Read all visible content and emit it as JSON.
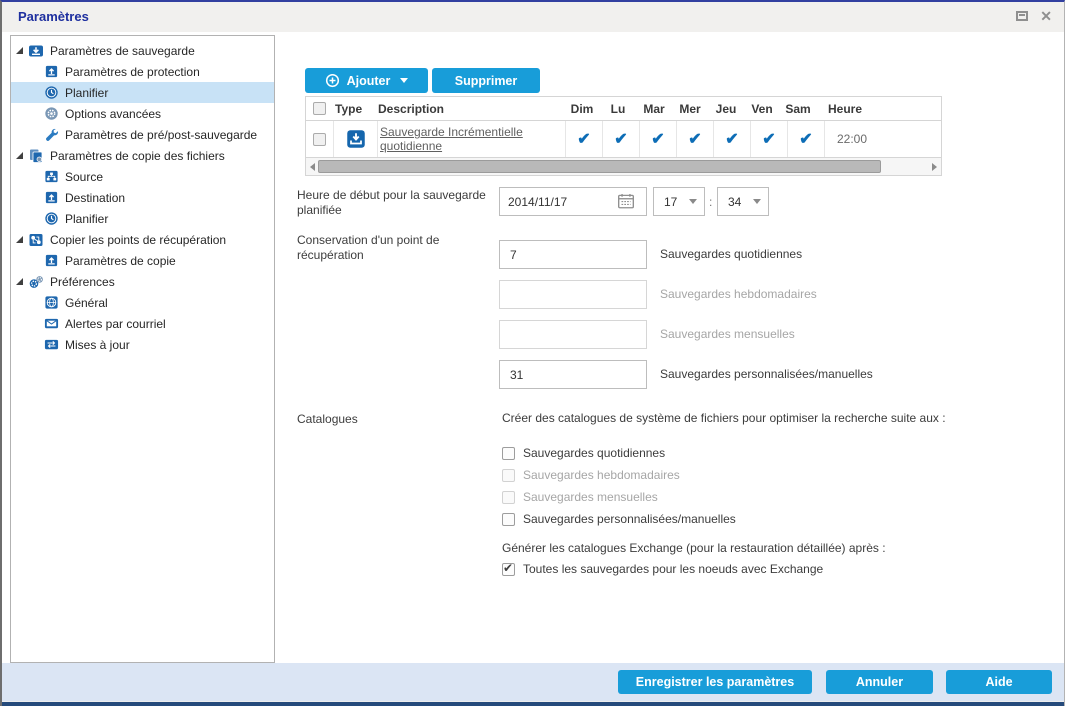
{
  "window": {
    "title": "Paramètres"
  },
  "sidebar": {
    "items": [
      {
        "label": "Paramètres de sauvegarde",
        "level": 0,
        "icon": "backup-settings",
        "expanded": true,
        "selected": false
      },
      {
        "label": "Paramètres de protection",
        "level": 1,
        "icon": "protection",
        "selected": false
      },
      {
        "label": "Planifier",
        "level": 1,
        "icon": "schedule",
        "selected": true
      },
      {
        "label": "Options avancées",
        "level": 1,
        "icon": "advanced-options",
        "selected": false
      },
      {
        "label": "Paramètres de pré/post-sauvegarde",
        "level": 1,
        "icon": "wrench",
        "selected": false
      },
      {
        "label": "Paramètres de copie des fichiers",
        "level": 0,
        "icon": "file-copy",
        "expanded": true,
        "selected": false
      },
      {
        "label": "Source",
        "level": 1,
        "icon": "network-source",
        "selected": false
      },
      {
        "label": "Destination",
        "level": 1,
        "icon": "protection",
        "selected": false
      },
      {
        "label": "Planifier",
        "level": 1,
        "icon": "schedule",
        "selected": false
      },
      {
        "label": "Copier les points de récupération",
        "level": 0,
        "icon": "recovery-copy",
        "expanded": true,
        "selected": false
      },
      {
        "label": "Paramètres de copie",
        "level": 1,
        "icon": "protection",
        "selected": false
      },
      {
        "label": "Préférences",
        "level": 0,
        "icon": "preferences",
        "expanded": true,
        "selected": false
      },
      {
        "label": "Général",
        "level": 1,
        "icon": "globe",
        "selected": false
      },
      {
        "label": "Alertes par courriel",
        "level": 1,
        "icon": "email",
        "selected": false
      },
      {
        "label": "Mises à jour",
        "level": 1,
        "icon": "updates",
        "selected": false
      }
    ]
  },
  "toolbar": {
    "add_label": "Ajouter",
    "delete_label": "Supprimer"
  },
  "schedule_table": {
    "col_type": "Type",
    "col_description": "Description",
    "day_columns": [
      "Dim",
      "Lu",
      "Mar",
      "Mer",
      "Jeu",
      "Ven",
      "Sam"
    ],
    "col_time": "Heure",
    "rows": [
      {
        "type_icon": "incremental-backup",
        "description": "Sauvegarde Incrémentielle quotidienne",
        "days": [
          true,
          true,
          true,
          true,
          true,
          true,
          true
        ],
        "time": "22:00"
      }
    ]
  },
  "start_time": {
    "label": "Heure de début pour la sauvegarde planifiée",
    "date": "2014/11/17",
    "hour": "17",
    "separator": ":",
    "minute": "34"
  },
  "retention": {
    "label": "Conservation d'un point de récupération",
    "fields": [
      {
        "value": "7",
        "label": "Sauvegardes quotidiennes",
        "enabled": true
      },
      {
        "value": "",
        "label": "Sauvegardes hebdomadaires",
        "enabled": false
      },
      {
        "value": "",
        "label": "Sauvegardes mensuelles",
        "enabled": false
      },
      {
        "value": "31",
        "label": "Sauvegardes personnalisées/manuelles",
        "enabled": true
      }
    ]
  },
  "catalogs": {
    "label": "Catalogues",
    "intro": "Créer des catalogues de système de fichiers pour optimiser la recherche suite aux :",
    "checkboxes": [
      {
        "label": "Sauvegardes quotidiennes",
        "checked": false,
        "enabled": true
      },
      {
        "label": "Sauvegardes hebdomadaires",
        "checked": false,
        "enabled": false
      },
      {
        "label": "Sauvegardes mensuelles",
        "checked": false,
        "enabled": false
      },
      {
        "label": "Sauvegardes personnalisées/manuelles",
        "checked": false,
        "enabled": true
      }
    ],
    "exchange_intro": "Générer les catalogues Exchange (pour la restauration détaillée) après :",
    "exchange_checkbox": {
      "label": "Toutes les sauvegardes pour les noeuds avec Exchange",
      "checked": true
    }
  },
  "footer": {
    "save_label": "Enregistrer les paramètres",
    "cancel_label": "Annuler",
    "help_label": "Aide"
  },
  "colors": {
    "accent_blue": "#189dd9",
    "check_blue": "#0d6db6",
    "selected_item_bg": "#c8e2f6",
    "title_navy": "#1e2f9f",
    "footer_bg": "#dbe5f4",
    "bottom_bar": "#254a7b"
  }
}
